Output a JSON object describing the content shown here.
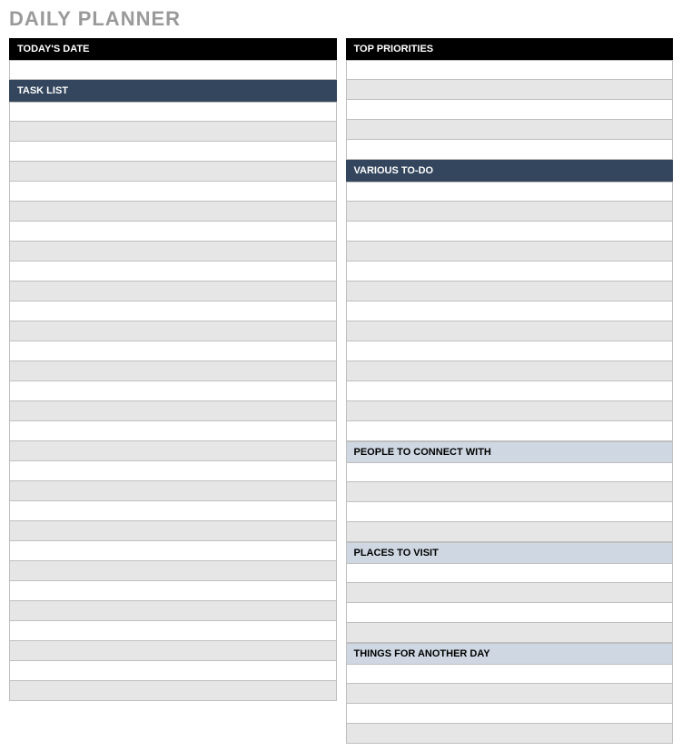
{
  "title": "DAILY PLANNER",
  "left": {
    "date_header": "TODAY'S DATE",
    "task_header": "TASK LIST"
  },
  "right": {
    "priorities_header": "TOP PRIORITIES",
    "various_header": "VARIOUS TO-DO",
    "people_header": "PEOPLE TO CONNECT WITH",
    "places_header": "PLACES TO VISIT",
    "things_header": "THINGS FOR ANOTHER DAY"
  }
}
